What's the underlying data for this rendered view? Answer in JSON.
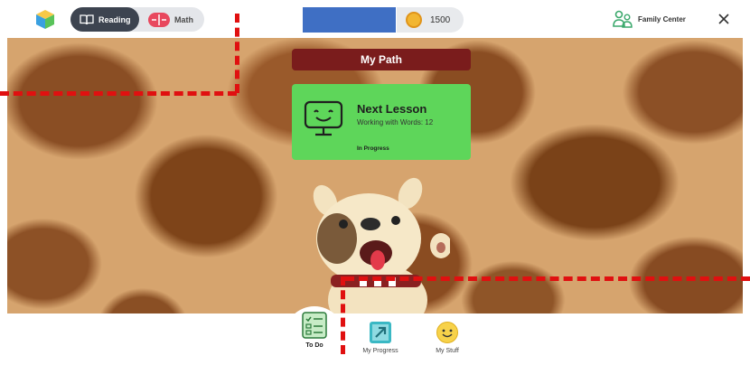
{
  "header": {
    "subjects": [
      {
        "label": "Reading",
        "icon": "book-icon",
        "selected": true
      },
      {
        "label": "Math",
        "icon": "math-icon",
        "selected": false
      }
    ],
    "coins": "1500",
    "family_center": "Family Center"
  },
  "main": {
    "path_title": "My Path",
    "lesson": {
      "title": "Next Lesson",
      "subtitle": "Working with Words: 12",
      "status": "In Progress",
      "icon": "smiling-computer-icon"
    },
    "character": "puppy-mascot"
  },
  "bottom_nav": [
    {
      "label": "To Do",
      "icon": "checklist-icon",
      "active": true
    },
    {
      "label": "My Progress",
      "icon": "arrow-icon",
      "active": false
    },
    {
      "label": "My Stuff",
      "icon": "smiley-icon",
      "active": false
    }
  ],
  "colors": {
    "path_banner": "#7a1c1c",
    "lesson_card": "#5ed65a",
    "reading_selected": "#3d4450",
    "overlay_dash": "#e01010"
  }
}
